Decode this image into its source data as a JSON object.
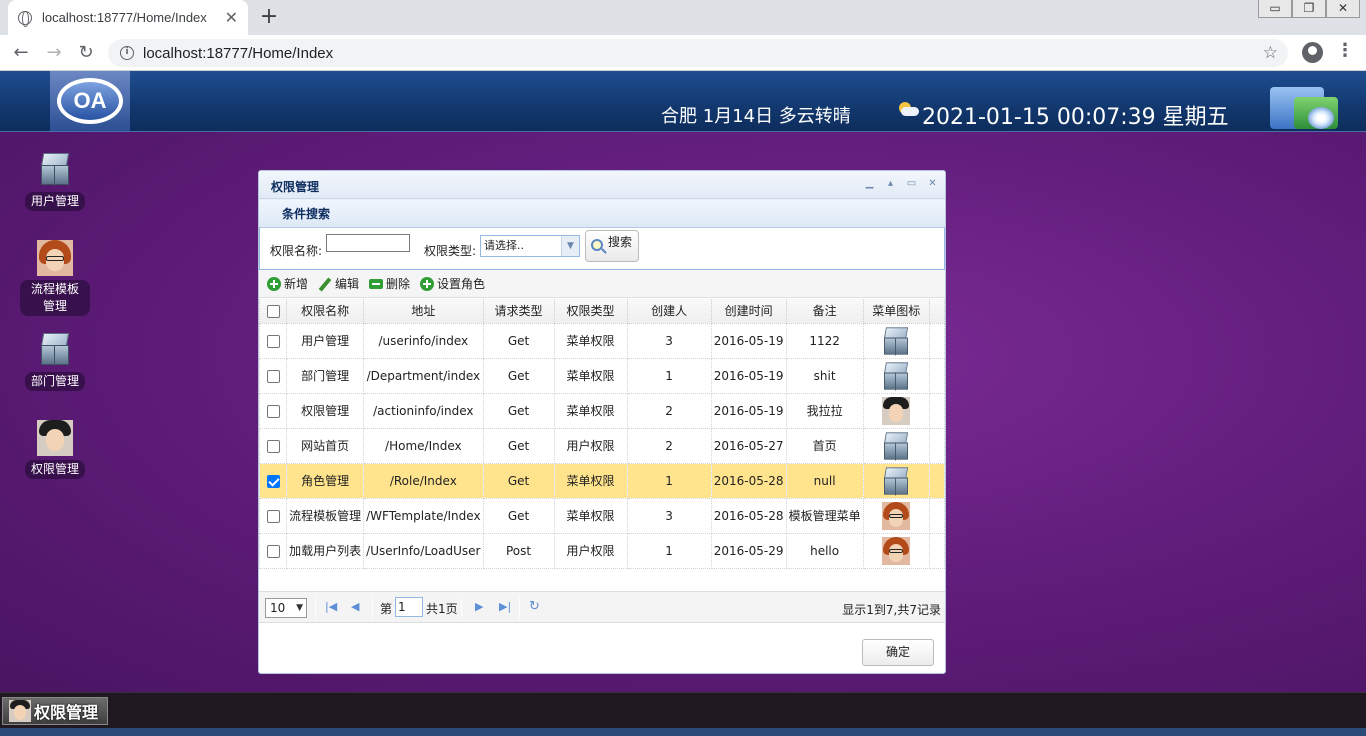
{
  "browser": {
    "tab_title": "localhost:18777/Home/Index",
    "url": "localhost:18777/Home/Index",
    "win_min": "▭",
    "win_max": "❐",
    "win_close": "✕"
  },
  "header": {
    "logo_text": "OA",
    "weather": "合肥 1月14日 多云转晴",
    "clock": "2021-01-15 00:07:39 星期五"
  },
  "desktop": {
    "icons": [
      {
        "label": "用户管理",
        "icon": "cube-icon"
      },
      {
        "label": "流程模板管理",
        "icon": "female-avatar-icon"
      },
      {
        "label": "部门管理",
        "icon": "cube-icon"
      },
      {
        "label": "权限管理",
        "icon": "male-avatar-icon"
      }
    ]
  },
  "window": {
    "title": "权限管理",
    "search_panel_title": "条件搜索",
    "name_label": "权限名称:",
    "name_value": "",
    "type_label": "权限类型:",
    "type_selected": "请选择..",
    "search_button": "搜索",
    "toolbar": {
      "add": "新增",
      "edit": "编辑",
      "delete": "删除",
      "set_role": "设置角色"
    },
    "columns": [
      "权限名称",
      "地址",
      "请求类型",
      "权限类型",
      "创建人",
      "创建时间",
      "备注",
      "菜单图标"
    ],
    "rows": [
      {
        "name": "用户管理",
        "url": "/userinfo/index",
        "method": "Get",
        "type": "菜单权限",
        "creator": "3",
        "created": "2016-05-19",
        "remark": "1122",
        "icon": "cube-icon",
        "checked": false
      },
      {
        "name": "部门管理",
        "url": "/Department/index",
        "method": "Get",
        "type": "菜单权限",
        "creator": "1",
        "created": "2016-05-19",
        "remark": "shit",
        "icon": "cube-icon",
        "checked": false
      },
      {
        "name": "权限管理",
        "url": "/actioninfo/index",
        "method": "Get",
        "type": "菜单权限",
        "creator": "2",
        "created": "2016-05-19",
        "remark": "我拉拉",
        "icon": "male-avatar-icon",
        "checked": false
      },
      {
        "name": "网站首页",
        "url": "/Home/Index",
        "method": "Get",
        "type": "用户权限",
        "creator": "2",
        "created": "2016-05-27",
        "remark": "首页",
        "icon": "cube-icon",
        "checked": false
      },
      {
        "name": "角色管理",
        "url": "/Role/Index",
        "method": "Get",
        "type": "菜单权限",
        "creator": "1",
        "created": "2016-05-28",
        "remark": "null",
        "icon": "cube-icon",
        "checked": true
      },
      {
        "name": "流程模板管理",
        "url": "/WFTemplate/Index",
        "method": "Get",
        "type": "菜单权限",
        "creator": "3",
        "created": "2016-05-28",
        "remark": "模板管理菜单",
        "icon": "female-avatar-icon",
        "checked": false
      },
      {
        "name": "加载用户列表",
        "url": "/UserInfo/LoadUser",
        "method": "Post",
        "type": "用户权限",
        "creator": "1",
        "created": "2016-05-29",
        "remark": "hello",
        "icon": "female-avatar-icon",
        "checked": false
      }
    ],
    "pager": {
      "page_size": "10",
      "page_prefix": "第",
      "page_number": "1",
      "page_total": "共1页",
      "summary": "显示1到7,共7记录"
    },
    "ok_button": "确定"
  },
  "taskbar": {
    "active_item": "权限管理"
  },
  "colors": {
    "selected_row": "#ffe48d",
    "desktop": "#6a237f",
    "header": "#12386f"
  }
}
